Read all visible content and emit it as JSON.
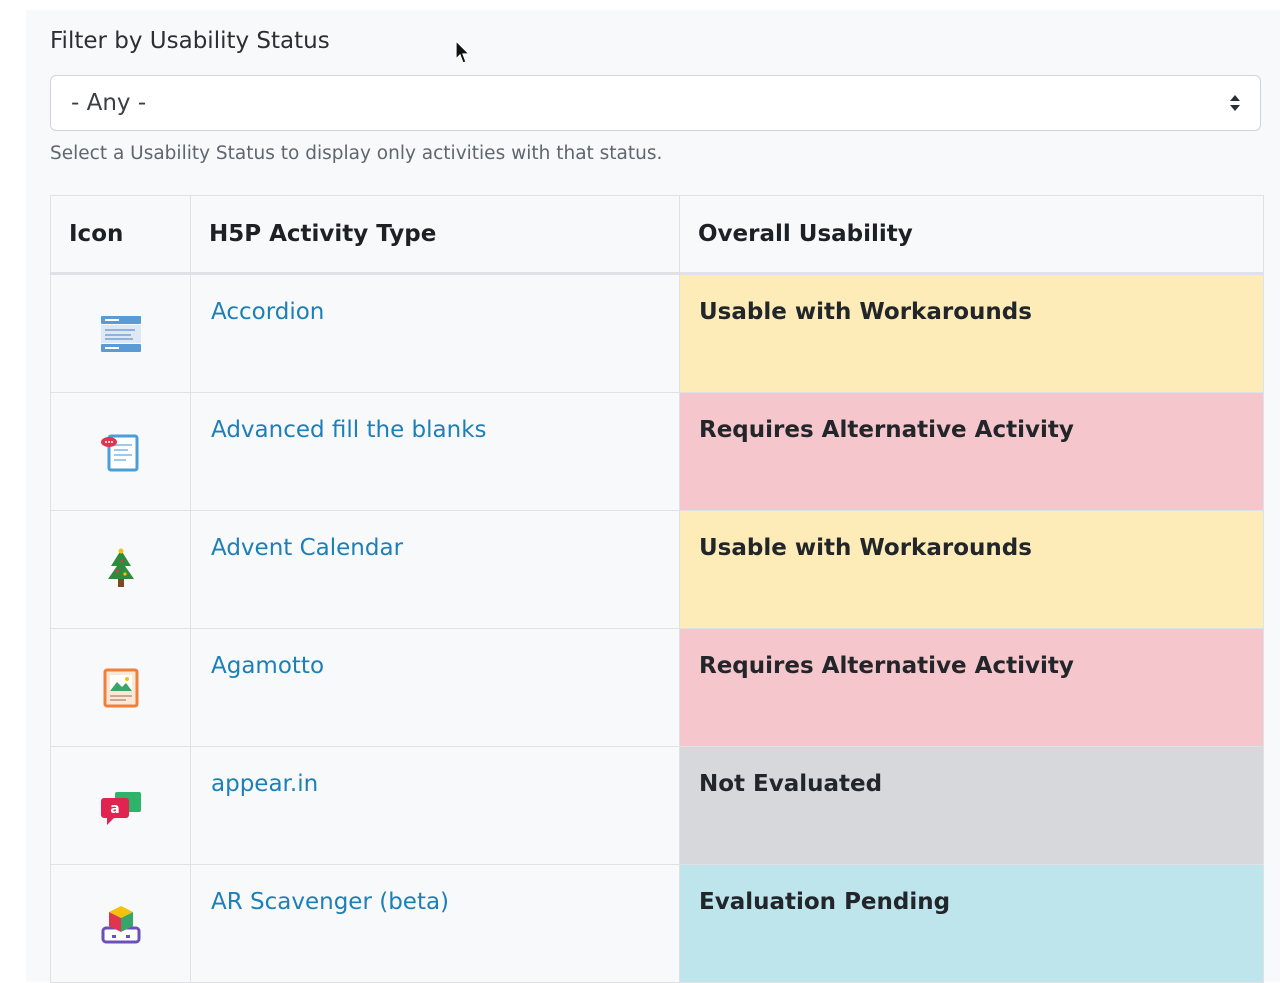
{
  "filter": {
    "label": "Filter by Usability Status",
    "selected": "- Any -",
    "help": "Select a Usability Status to display only activities with that status."
  },
  "table": {
    "headers": {
      "icon": "Icon",
      "type": "H5P Activity Type",
      "usability": "Overall Usability"
    },
    "rows": [
      {
        "name": "Accordion",
        "status": "Usable with Workarounds",
        "status_color": "#fdecb8",
        "icon": "accordion-icon"
      },
      {
        "name": "Advanced fill the blanks",
        "status": "Requires Alternative Activity",
        "status_color": "#f5c6cb",
        "icon": "advanced-fill-blanks-icon"
      },
      {
        "name": "Advent Calendar",
        "status": "Usable with Workarounds",
        "status_color": "#fdecb8",
        "icon": "christmas-tree-icon"
      },
      {
        "name": "Agamotto",
        "status": "Requires Alternative Activity",
        "status_color": "#f5c6cb",
        "icon": "image-frame-icon"
      },
      {
        "name": "appear.in",
        "status": "Not Evaluated",
        "status_color": "#d6d8db",
        "icon": "video-chat-icon"
      },
      {
        "name": "AR Scavenger (beta)",
        "status": "Evaluation Pending",
        "status_color": "#bee5eb",
        "icon": "ar-cube-icon"
      }
    ]
  }
}
